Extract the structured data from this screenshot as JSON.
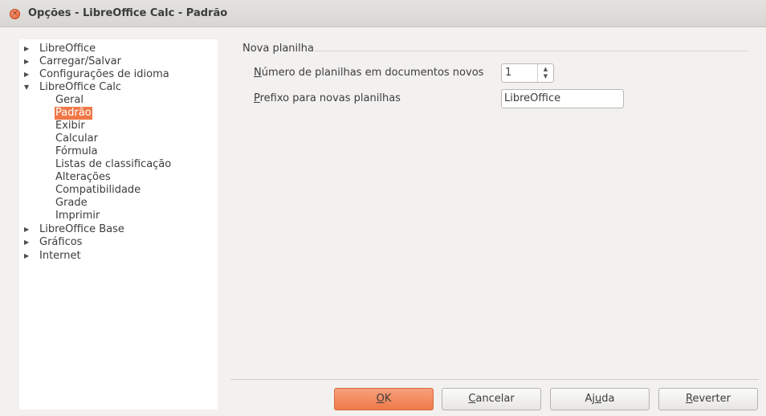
{
  "window": {
    "title": "Opções - LibreOffice Calc - Padrão",
    "close_glyph": "×"
  },
  "tree": [
    {
      "label": "LibreOffice",
      "arrow": "▶",
      "level": 0
    },
    {
      "label": "Carregar/Salvar",
      "arrow": "▶",
      "level": 0
    },
    {
      "label": "Configurações de idioma",
      "arrow": "▶",
      "level": 0
    },
    {
      "label": "LibreOffice Calc",
      "arrow": "▼",
      "level": 0
    },
    {
      "label": "Geral",
      "level": 1
    },
    {
      "label": "Padrão",
      "level": 1,
      "selected": true
    },
    {
      "label": "Exibir",
      "level": 1
    },
    {
      "label": "Calcular",
      "level": 1
    },
    {
      "label": "Fórmula",
      "level": 1
    },
    {
      "label": "Listas de classificação",
      "level": 1
    },
    {
      "label": "Alterações",
      "level": 1
    },
    {
      "label": "Compatibilidade",
      "level": 1
    },
    {
      "label": "Grade",
      "level": 1
    },
    {
      "label": "Imprimir",
      "level": 1
    },
    {
      "label": "LibreOffice Base",
      "arrow": "▶",
      "level": 0
    },
    {
      "label": "Gráficos",
      "arrow": "▶",
      "level": 0
    },
    {
      "label": "Internet",
      "arrow": "▶",
      "level": 0
    }
  ],
  "section": {
    "title": "Nova planilha"
  },
  "sheets_count": {
    "label_mnemonic": "N",
    "label_rest": "úmero de planilhas em documentos novos",
    "value": "1",
    "up_glyph": "▲",
    "down_glyph": "▼"
  },
  "prefix": {
    "label_mnemonic": "P",
    "label_rest": "refixo para novas planilhas",
    "value": "LibreOffice"
  },
  "buttons": {
    "ok": {
      "mnemonic": "O",
      "rest": "K"
    },
    "cancel": {
      "mnemonic": "C",
      "rest": "ancelar"
    },
    "help": {
      "pre": "Aj",
      "mnemonic": "u",
      "rest": "da"
    },
    "revert": {
      "mnemonic": "R",
      "rest": "everter"
    }
  },
  "colors": {
    "accent": "#f07746",
    "background": "#f2f1f0"
  }
}
